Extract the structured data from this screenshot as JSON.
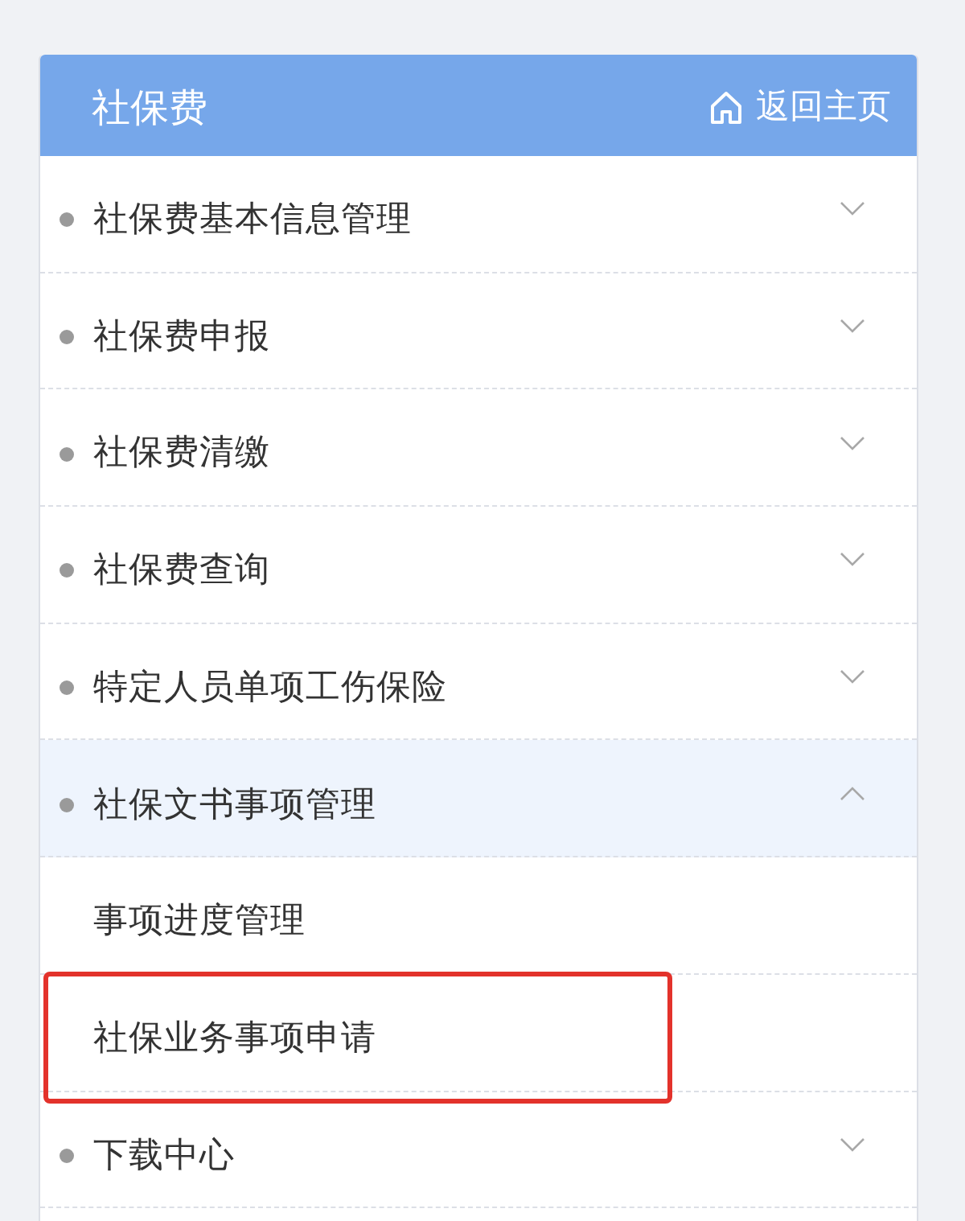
{
  "header": {
    "title": "社保费",
    "home_link": "返回主页"
  },
  "menu": [
    {
      "label": "社保费基本信息管理",
      "expanded": false
    },
    {
      "label": "社保费申报",
      "expanded": false
    },
    {
      "label": "社保费清缴",
      "expanded": false
    },
    {
      "label": "社保费查询",
      "expanded": false
    },
    {
      "label": "特定人员单项工伤保险",
      "expanded": false
    },
    {
      "label": "社保文书事项管理",
      "expanded": true,
      "children": [
        {
          "label": "事项进度管理",
          "highlighted": false
        },
        {
          "label": "社保业务事项申请",
          "highlighted": true
        }
      ]
    },
    {
      "label": "下载中心",
      "expanded": false
    }
  ]
}
